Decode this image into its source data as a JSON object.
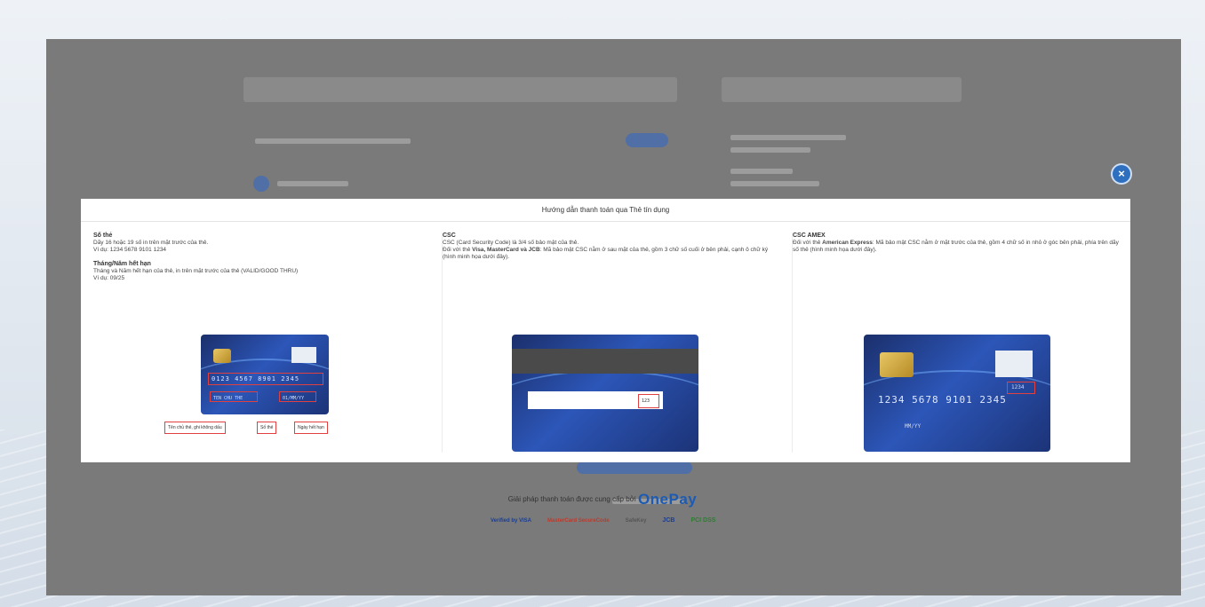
{
  "modal": {
    "title": "Hướng dẫn thanh toán qua Thẻ tín dụng",
    "close_icon": "close-icon",
    "columns": [
      {
        "heading": "Số thẻ",
        "text": "Dãy 16 hoặc 19 số in trên mặt trước của thẻ.",
        "example": "Ví dụ: 1234 5678 9101 1234",
        "heading2": "Tháng/Năm hết hạn",
        "text2": "Tháng và Năm hết hạn của thẻ, in trên mặt trước của thẻ (VALID/GOOD THRU)",
        "example2": "Ví dụ: 09/25",
        "card_number": "0123 4567 8901 2345",
        "card_name": "TEN CHU THE",
        "card_expiry": "01/MM/YY",
        "legend": [
          "Tên chủ thẻ, ghi không dấu",
          "Số thẻ",
          "Ngày hết hạn"
        ]
      },
      {
        "heading": "CSC",
        "text": "CSC (Card Security Code) là 3/4 số bảo mật của thẻ.",
        "text_prefix": "Đối với thẻ ",
        "text_bold": "Visa, MasterCard và JCB",
        "text_suffix": ": Mã bảo mật CSC nằm ở sau mặt của thẻ, gồm 3 chữ số cuối ở bên phải, cạnh ô chữ ký (hình minh họa dưới đây).",
        "csc_value": "123"
      },
      {
        "heading": "CSC AMEX",
        "text_prefix": "Đối với thẻ ",
        "text_bold": "American Express",
        "text_suffix": ": Mã bảo mật CSC nằm ở mặt trước của thẻ, gồm 4 chữ số in nhỏ ở góc bên phải, phía trên dãy số thẻ (hình minh họa dưới đây).",
        "card_number": "1234 5678 9101 2345",
        "card_csc": "1234",
        "card_expiry": "MM/YY"
      }
    ]
  },
  "footer": {
    "provider_text": "Giải pháp thanh toán được cung cấp bởi",
    "brand": "OnePay",
    "logos": [
      "Verified by VISA",
      "MasterCard SecureCode",
      "SafeKey",
      "JCB",
      "PCI DSS"
    ]
  },
  "colors": {
    "accent": "#1d5bb3",
    "overlay": "#7a7a7a",
    "card": "#2c56b8",
    "highlight": "#e04040"
  }
}
